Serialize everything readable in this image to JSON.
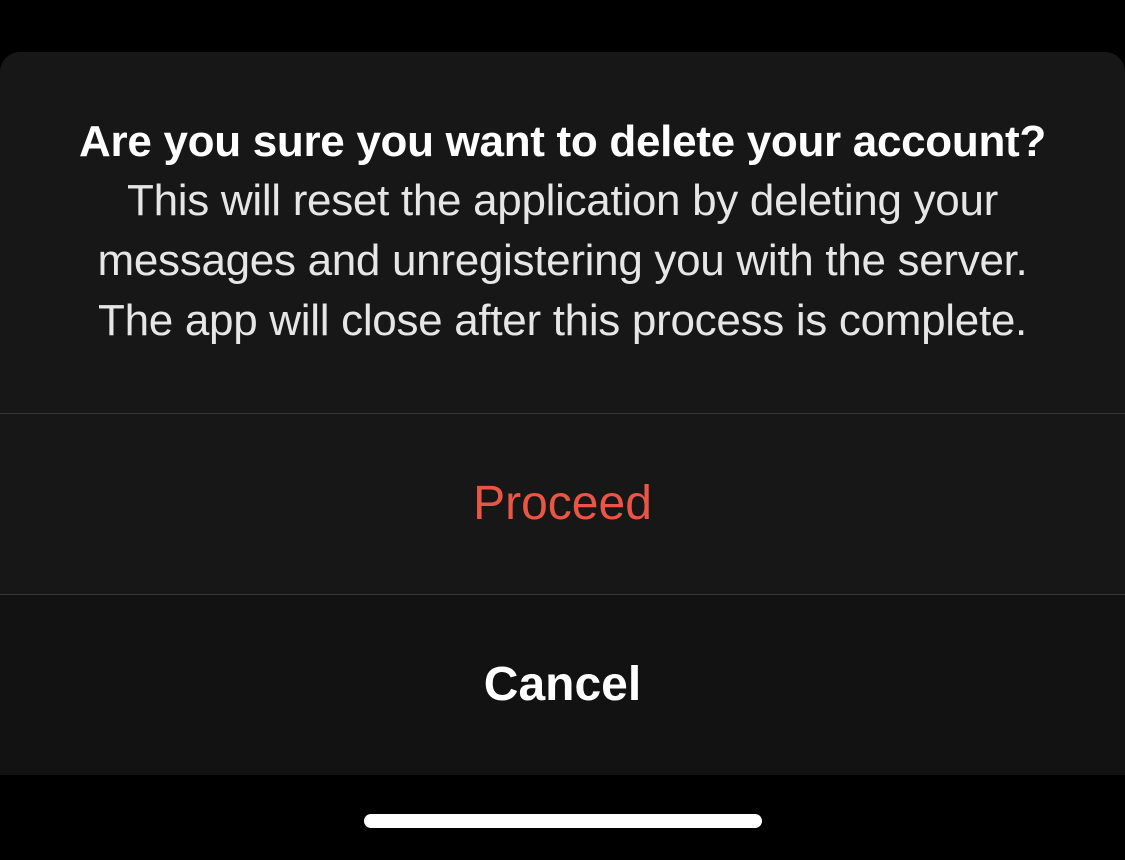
{
  "dialog": {
    "title": "Are you sure you want to delete your account?",
    "body": "This will reset the application by deleting your messages and unregistering you with the server. The app will close after this process is complete.",
    "proceed_label": "Proceed",
    "cancel_label": "Cancel"
  },
  "colors": {
    "destructive": "#eb5545",
    "background": "#000000",
    "sheet_background": "#171717",
    "text_primary": "#ffffff",
    "divider": "#353535"
  }
}
